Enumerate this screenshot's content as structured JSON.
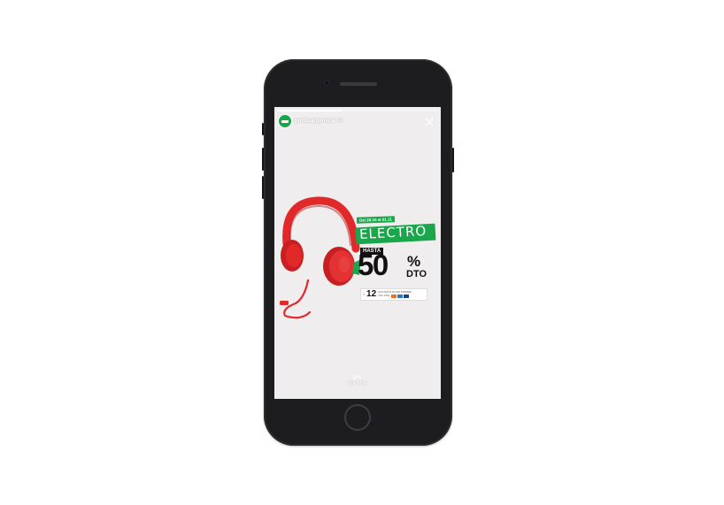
{
  "story": {
    "username": "jumboargentina",
    "time_ago": "4h",
    "progress_fraction": 0.4,
    "footer_label": "Ver Más"
  },
  "ad": {
    "date_range": "Del 28.10 al 01.11",
    "category": "ELECTRO",
    "prefix": "HASTA",
    "discount_value": "50",
    "percent_symbol": "%",
    "discount_suffix": "DTO",
    "installments_prefix": "Y",
    "installments_number": "12",
    "installments_text": "CUOTAS PLAN SIN INTERÉS",
    "cards_label": "TOC VISA"
  },
  "colors": {
    "brand_green": "#1aa64a",
    "headphone_red": "#e1292a",
    "phone_body": "#1d1d1f",
    "screen_bg": "#efedee"
  },
  "icons": {
    "avatar": "jumbo-logo-icon",
    "close": "close-icon",
    "swipe_up": "chevron-up-icon",
    "product": "headphones-icon"
  }
}
